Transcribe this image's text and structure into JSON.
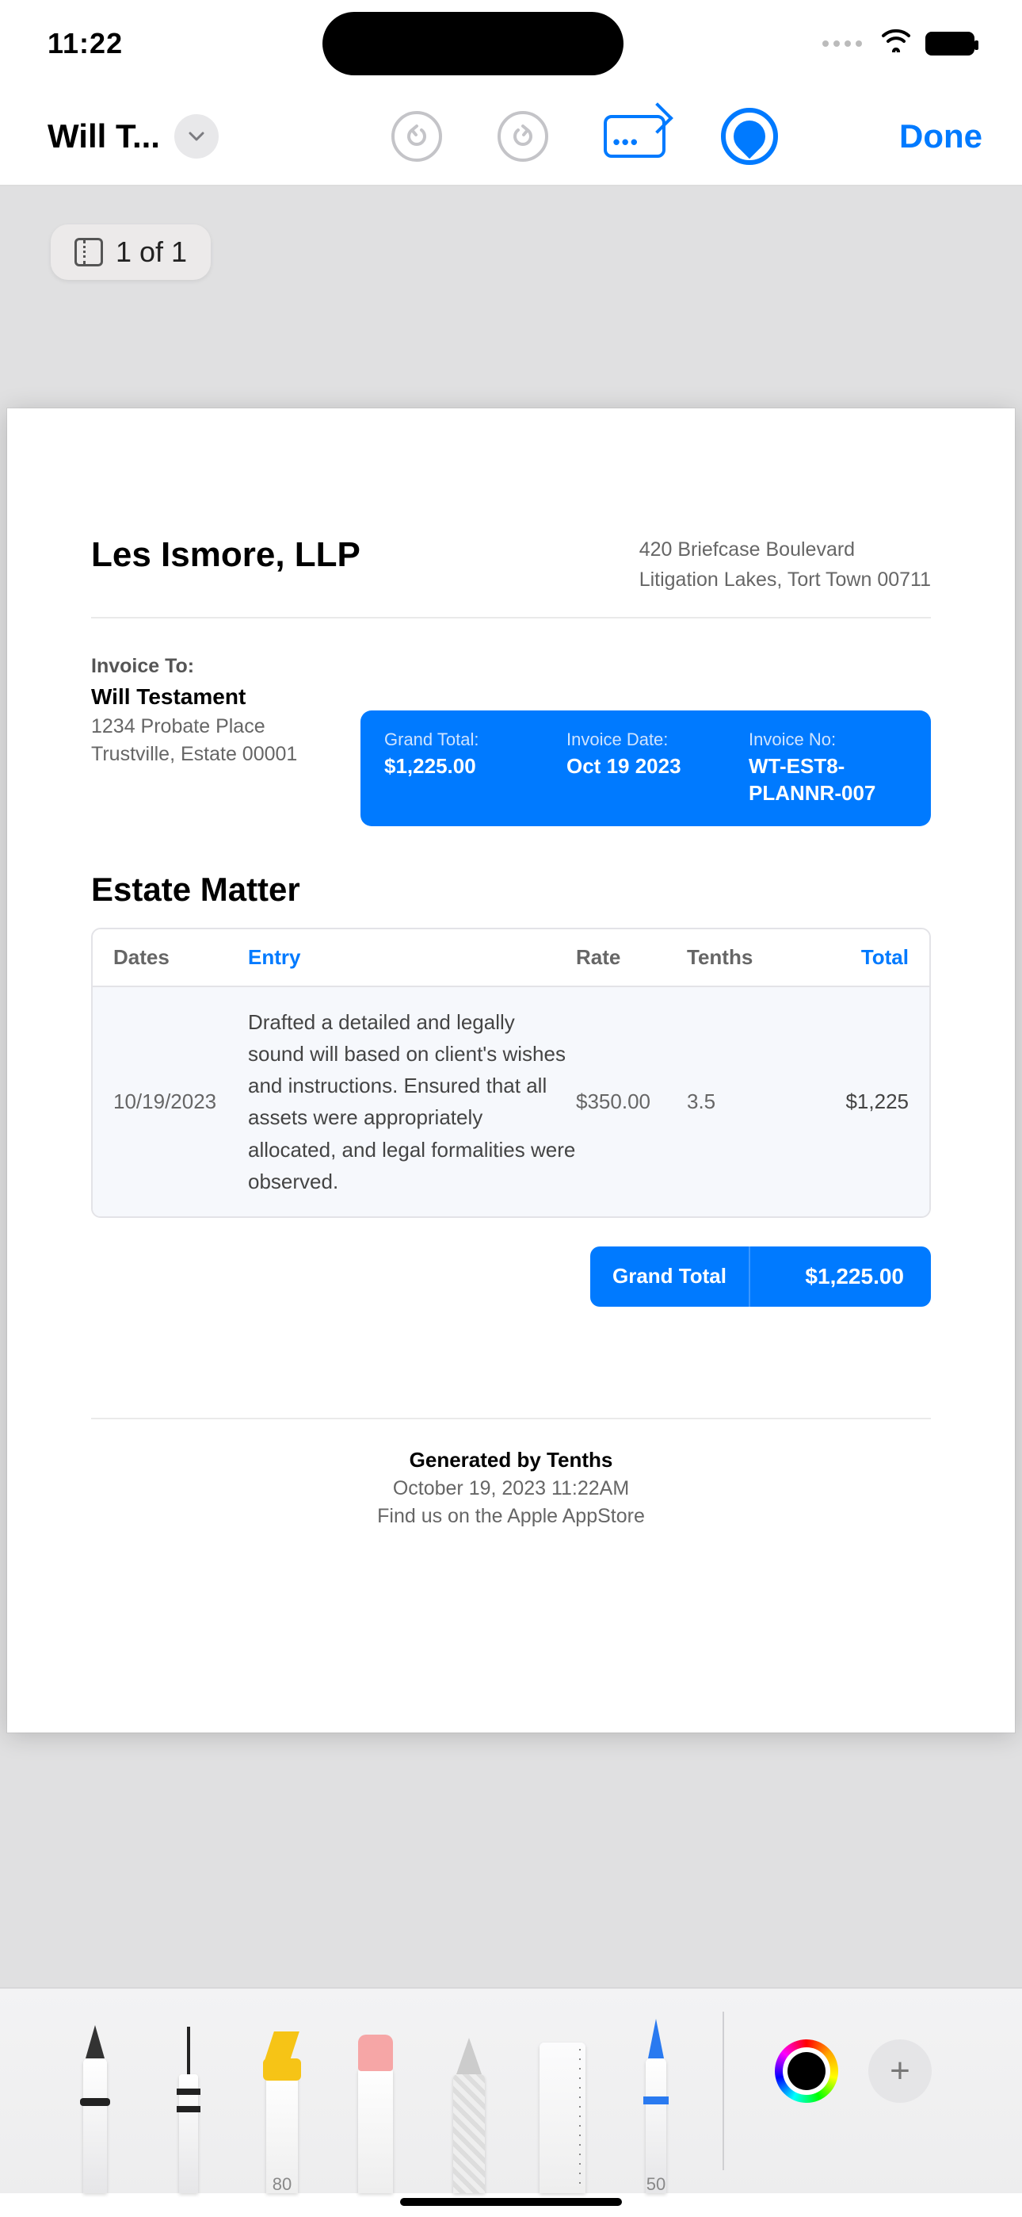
{
  "status": {
    "time": "11:22"
  },
  "nav": {
    "doc_title": "Will T...",
    "done_label": "Done"
  },
  "page_indicator": "1 of 1",
  "invoice": {
    "firm_name": "Les Ismore, LLP",
    "firm_addr1": "420 Briefcase Boulevard",
    "firm_addr2": "Litigation Lakes, Tort Town 00711",
    "to_label": "Invoice To:",
    "to_name": "Will Testament",
    "to_addr1": "1234 Probate Place",
    "to_addr2": "Trustville, Estate 00001",
    "summary": {
      "grand_total_label": "Grand Total:",
      "grand_total_value": "$1,225.00",
      "date_label": "Invoice Date:",
      "date_value": "Oct 19 2023",
      "no_label": "Invoice No:",
      "no_value": "WT-EST8-PLANNR-007"
    },
    "section_title": "Estate Matter",
    "table": {
      "headers": {
        "dates": "Dates",
        "entry": "Entry",
        "rate": "Rate",
        "tenths": "Tenths",
        "total": "Total"
      },
      "row": {
        "date": "10/19/2023",
        "entry": "Drafted a detailed and legally sound will based on client's wishes and instructions. Ensured that all assets were appropriately allocated, and legal formalities were observed.",
        "rate": "$350.00",
        "tenths": "3.5",
        "total": "$1,225"
      }
    },
    "grand": {
      "label": "Grand Total",
      "value": "$1,225.00"
    },
    "footer": {
      "gen": "Generated by Tenths",
      "timestamp": "October 19, 2023 11:22AM",
      "appstore": "Find us on the Apple AppStore"
    }
  },
  "tools": {
    "highlighter_size": "80",
    "bluepen_size": "50"
  }
}
